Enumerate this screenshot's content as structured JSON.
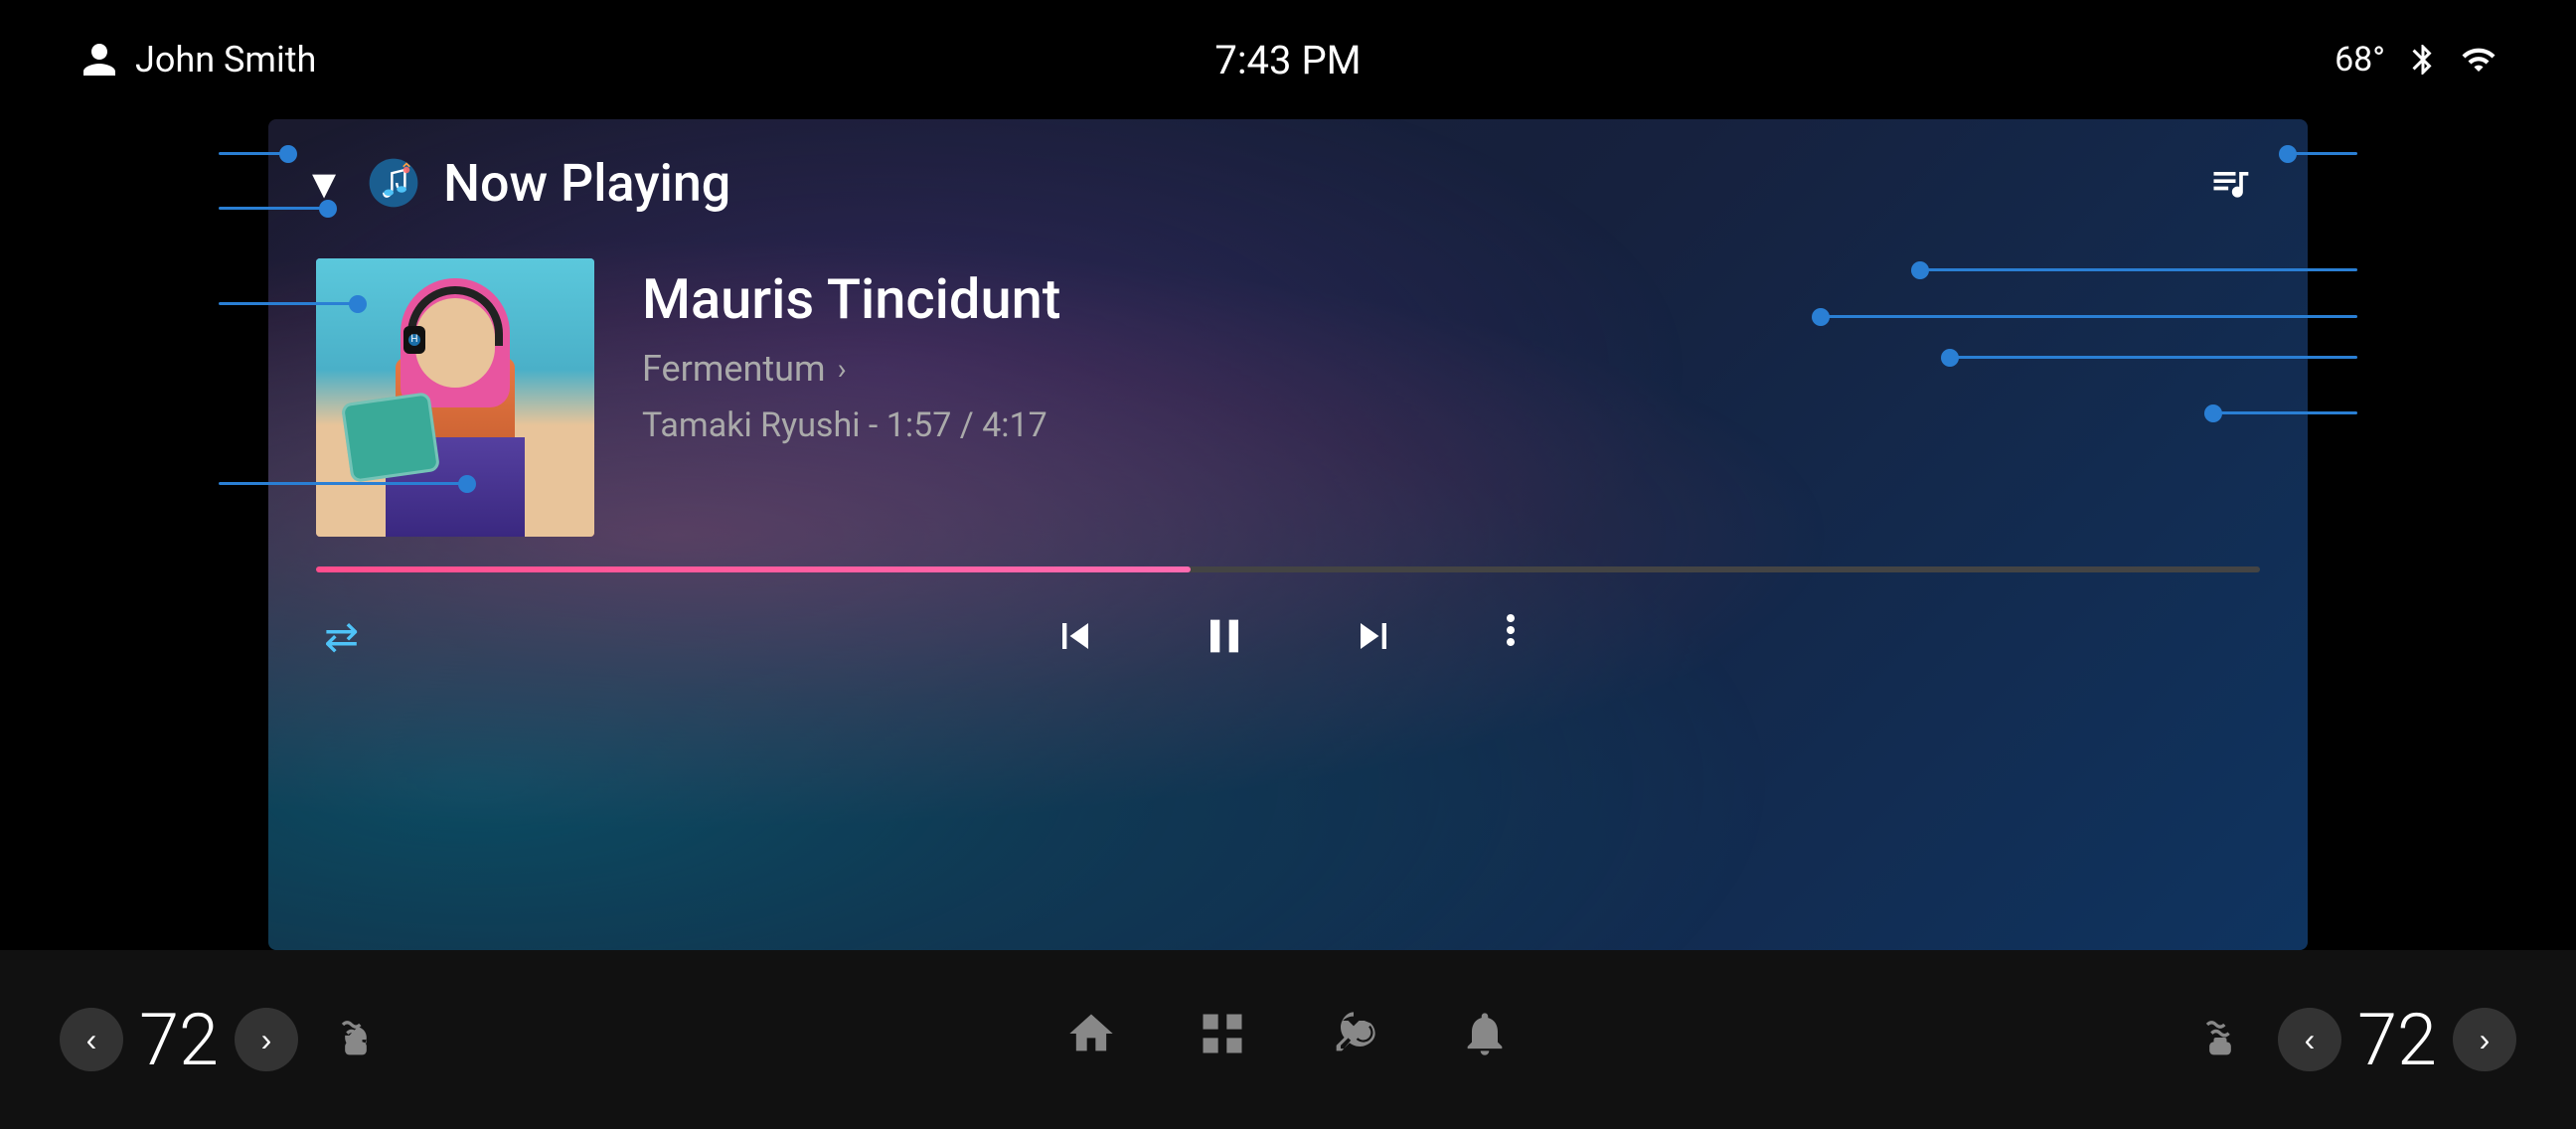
{
  "statusBar": {
    "user": "John Smith",
    "time": "7:43 PM",
    "temperature": "68°",
    "bluetooth": "bluetooth",
    "signal": "signal"
  },
  "header": {
    "title": "Now Playing",
    "chevron": "▾",
    "queueIcon": "queue-music"
  },
  "track": {
    "title": "Mauris Tincidunt",
    "album": "Fermentum",
    "artistTime": "Tamaki Ryushi - 1:57 / 4:17",
    "progressPercent": 45,
    "currentTime": "1:57",
    "totalTime": "4:17"
  },
  "controls": {
    "repeat": "⇄",
    "previous": "⏮",
    "pause": "⏸",
    "next": "⏭",
    "more": "⋮"
  },
  "bottomBar": {
    "leftTemp": {
      "value": "72",
      "decreaseLabel": "‹",
      "increaseLabel": "›",
      "heatIcon": "seat-heat-left"
    },
    "nav": {
      "home": "home",
      "grid": "grid",
      "fan": "fan",
      "bell": "bell"
    },
    "rightTemp": {
      "value": "72",
      "decreaseLabel": "‹",
      "increaseLabel": "›",
      "heatIcon": "seat-heat-right"
    }
  }
}
